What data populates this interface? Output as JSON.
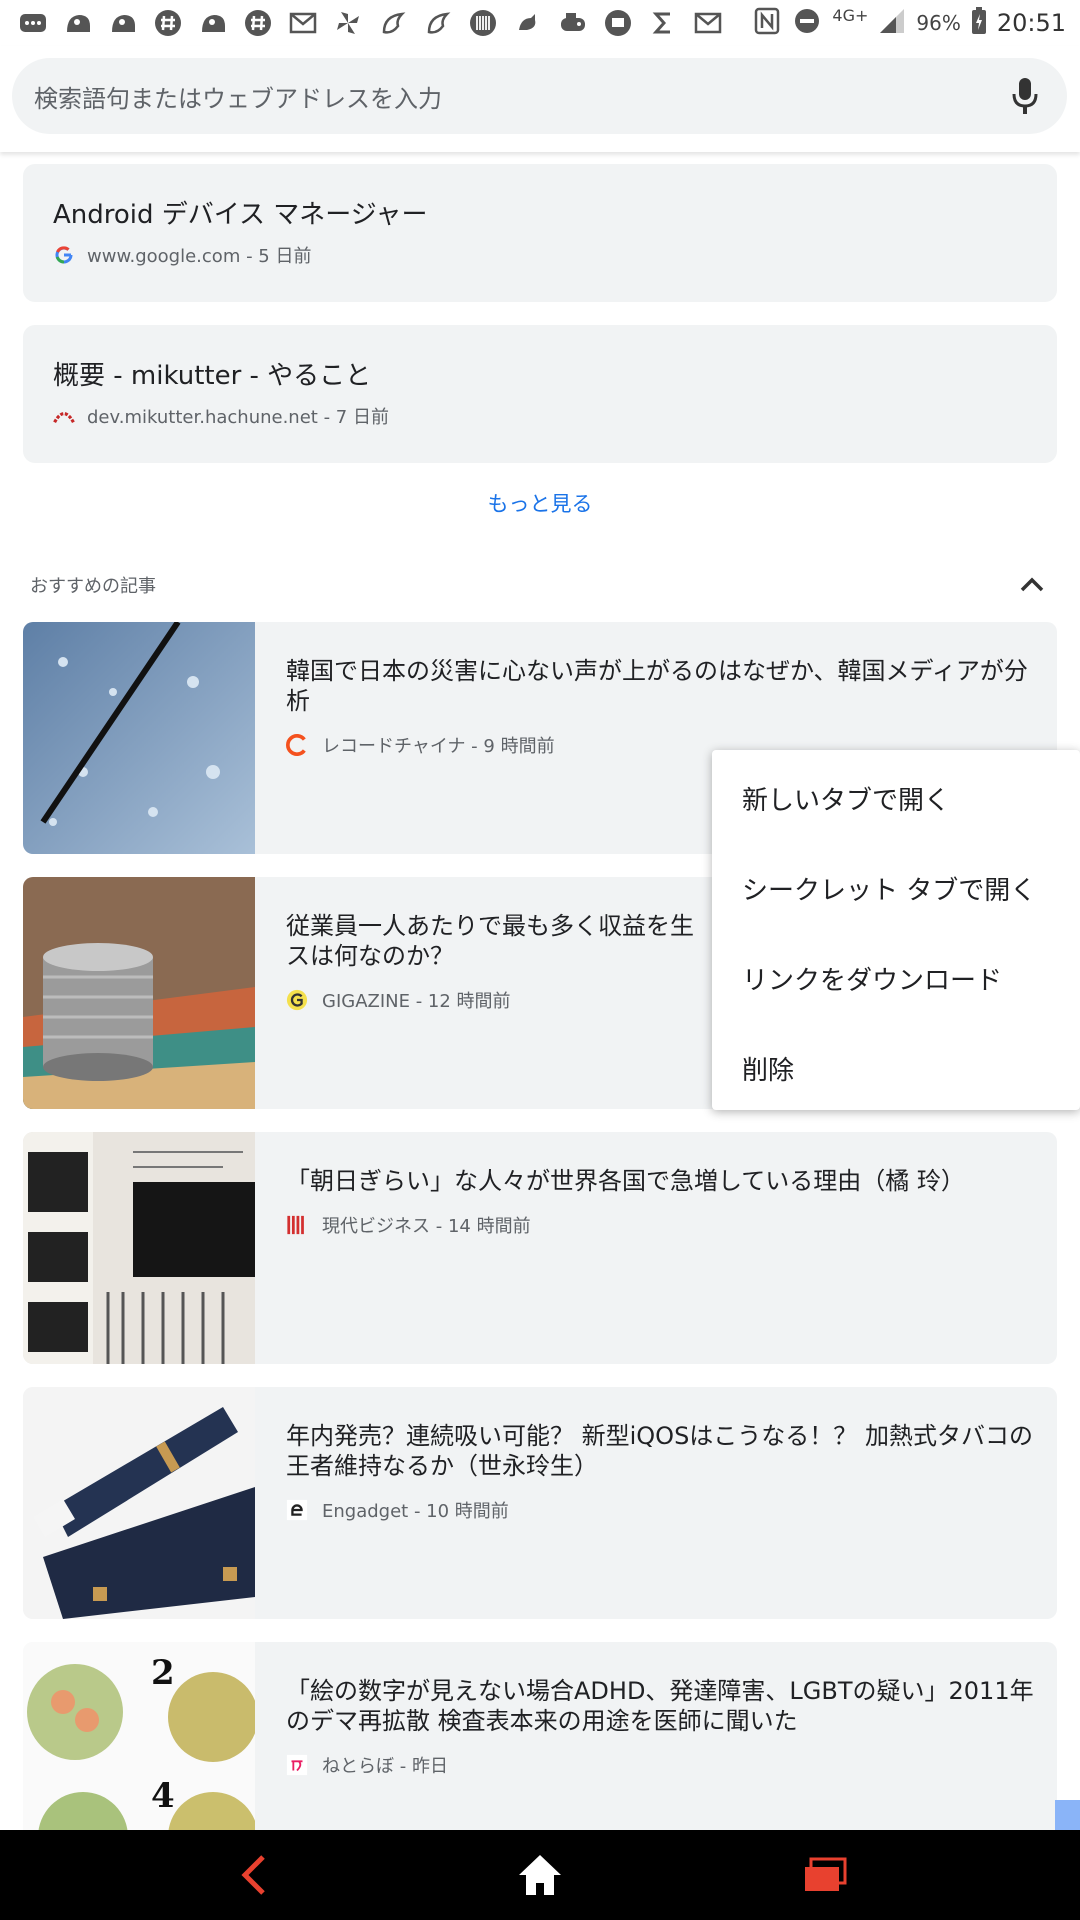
{
  "status_bar": {
    "network": "4G+",
    "battery": "96%",
    "time": "20:51",
    "notification_icons": [
      "cat-icon",
      "cat-icon",
      "cat-icon",
      "hash-icon",
      "cat-icon",
      "hash-icon",
      "gmail-icon",
      "pinwheel-icon",
      "leaf-icon",
      "leaf-icon",
      "barcode-icon",
      "bird-icon",
      "game-icon",
      "tv-icon",
      "s-icon",
      "gmail-icon"
    ]
  },
  "omnibox": {
    "placeholder": "検索語句またはウェブアドレスを入力"
  },
  "history": [
    {
      "title": "Android デバイス マネージャー",
      "meta": "www.google.com - 5 日前",
      "favicon": "google-icon"
    },
    {
      "title": "概要 - mikutter - やること",
      "meta": "dev.mikutter.hachune.net - 7 日前",
      "favicon": "mikutter-icon"
    }
  ],
  "more_label": "もっと見る",
  "section_title": "おすすめの記事",
  "articles": [
    {
      "title": "韓国で日本の災害に心ない声が上がるのはなぜか、韓国メディアが分析",
      "meta": "レコードチャイナ - 9 時間前",
      "favicon": "recordchina-icon"
    },
    {
      "title": "従業員一人あたりで最も多く収益を生み出しているのはどこの企業で、そのビジネスは何なのか？",
      "title_visible": "従業員一人あたりで最も多く収益を生",
      "title_visible2": "スは何なのか？",
      "meta": "GIGAZINE - 12 時間前",
      "favicon": "gigazine-icon"
    },
    {
      "title": "「朝日ぎらい」な人々が世界各国で急増している理由（橘 玲）",
      "meta": "現代ビジネス - 14 時間前",
      "favicon": "gendai-icon"
    },
    {
      "title": "年内発売？連続吸い可能？ 新型iQOSはこうなる！？ 加熱式タバコの王者維持なるか（世永玲生）",
      "meta": "Engadget - 10 時間前",
      "favicon": "engadget-icon"
    },
    {
      "title": "「絵の数字が見えない場合ADHD、発達障害、LGBTの疑い」2011年のデマ再拡散 検査表本来の用途を医師に聞いた",
      "meta": "ねとらぼ - 昨日",
      "favicon": "netorabo-icon"
    }
  ],
  "context_menu": {
    "items": [
      "新しいタブで開く",
      "シークレット タブで開く",
      "リンクをダウンロード",
      "削除"
    ]
  },
  "colors": {
    "accent": "#1a73e8",
    "card_bg": "#f1f3f4",
    "nav_icon": "#e8412f"
  }
}
